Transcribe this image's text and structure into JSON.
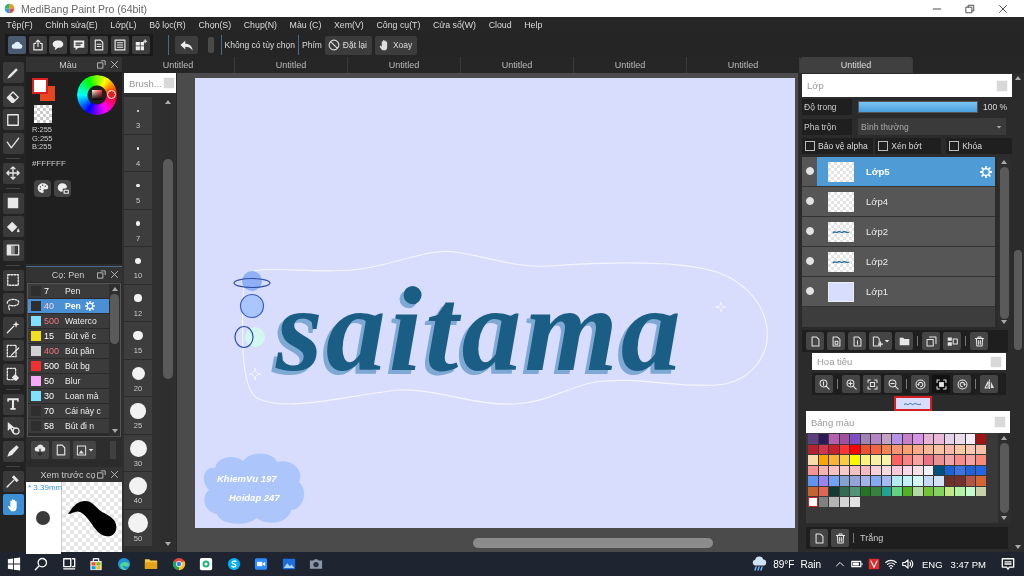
{
  "window": {
    "title": "MediBang Paint Pro (64bit)"
  },
  "menu": [
    "Tệp(F)",
    "Chỉnh sửa(E)",
    "Lớp(L)",
    "Bộ lọc(R)",
    "Chọn(S)",
    "Chụp(N)",
    "Màu (C)",
    "Xem(V)",
    "Công cụ(T)",
    "Cửa sổ(W)",
    "Cloud",
    "Help"
  ],
  "toolbar": {
    "options_text": "Không có tùy chọn",
    "key_label": "Phím",
    "buttons": [
      "Đặt lại",
      "Xoay"
    ]
  },
  "tools": [
    {
      "selected": false
    },
    {
      "selected": false
    },
    {
      "selected": false
    },
    {
      "selected": false
    },
    {
      "selected": false
    },
    {
      "selected": false
    },
    {
      "selected": false
    },
    {
      "selected": false
    },
    {
      "selected": false
    },
    {
      "selected": false
    },
    {
      "selected": false
    },
    {
      "selected": false
    },
    {
      "selected": false
    },
    {
      "selected": false
    },
    {
      "selected": false
    },
    {
      "selected": false
    },
    {
      "selected": false
    },
    {
      "selected": true
    }
  ],
  "color_panel": {
    "title": "Màu",
    "rgb": [
      "R:255",
      "G:255",
      "B:255"
    ],
    "hex": "#FFFFFF"
  },
  "brush_panel": {
    "title": "Cọ: Pen",
    "items": [
      {
        "color": "#2e2e2e",
        "size": "7",
        "size_highlighted": false,
        "name": "Pen",
        "selected": false
      },
      {
        "color": "#2e2e2e",
        "size": "40",
        "size_highlighted": true,
        "name": "Pen",
        "selected": true
      },
      {
        "color": "#7fe0ff",
        "size": "500",
        "size_highlighted": true,
        "name": "Waterco",
        "selected": false
      },
      {
        "color": "#f0e020",
        "size": "15",
        "size_highlighted": false,
        "name": "Bút vẽ c",
        "selected": false
      },
      {
        "color": "#d2d2d2",
        "size": "400",
        "size_highlighted": true,
        "name": "Bút pần",
        "selected": false
      },
      {
        "color": "#f03030",
        "size": "500",
        "size_highlighted": false,
        "name": "Bút bg",
        "selected": false
      },
      {
        "color": "#f8a8f8",
        "size": "50",
        "size_highlighted": false,
        "name": "Blur",
        "selected": false
      },
      {
        "color": "#7fe0ff",
        "size": "30",
        "size_highlighted": false,
        "name": "Loan mà",
        "selected": false
      },
      {
        "color": "#2e2e2e",
        "size": "70",
        "size_highlighted": false,
        "name": "Cái này c",
        "selected": false
      },
      {
        "color": "#2e2e2e",
        "size": "58",
        "size_highlighted": false,
        "name": "Bút đi n",
        "selected": false
      }
    ]
  },
  "brush_preview": {
    "title": "Xem trước cọ",
    "size": "* 3.39mm"
  },
  "brush_sizes": {
    "title": "Brush...",
    "items": [
      "3",
      "4",
      "5",
      "7",
      "10",
      "12",
      "15",
      "20",
      "25",
      "30",
      "40",
      "50"
    ]
  },
  "document_tabs": [
    {
      "label": "Untitled",
      "selected": false
    },
    {
      "label": "Untitled",
      "selected": false
    },
    {
      "label": "Untitled",
      "selected": false
    },
    {
      "label": "Untitled",
      "selected": false
    },
    {
      "label": "Untitled",
      "selected": false
    },
    {
      "label": "Untitled",
      "selected": false
    },
    {
      "label": "Untitled",
      "selected": true
    }
  ],
  "canvas": {
    "lettering": "saitama",
    "signature": [
      "KhiemVu 197",
      "Hoidap 247"
    ]
  },
  "layer_panel": {
    "title": "Lớp",
    "opacity_label": "Độ trong",
    "opacity": {
      "level": 1.0
    },
    "opacity_value": "100 %",
    "blend_label": "Pha trộn",
    "blend_mode": "Bình thường",
    "options": [
      {
        "label": "Bảo vệ alpha",
        "checked": false
      },
      {
        "label": "Xén bớt",
        "checked": false
      },
      {
        "label": "Khóa",
        "checked": false
      }
    ],
    "layers": [
      {
        "name": "Lớp5",
        "selected": true,
        "visible": true,
        "kind": "empty"
      },
      {
        "name": "Lớp4",
        "selected": false,
        "visible": true,
        "kind": "empty"
      },
      {
        "name": "Lớp2",
        "selected": false,
        "visible": true,
        "kind": "lettering"
      },
      {
        "name": "Lớp2",
        "selected": false,
        "visible": true,
        "kind": "lettering"
      },
      {
        "name": "Lớp1",
        "selected": false,
        "visible": true,
        "kind": "fill"
      }
    ]
  },
  "navigator": {
    "title": "Hoa tiêu"
  },
  "palette": {
    "title": "Bảng màu",
    "color_name": "Trắng",
    "swatches": [
      {
        "color": "#5c3f7e",
        "selected": false
      },
      {
        "color": "#2b1a55",
        "selected": false
      },
      {
        "color": "#b45fb0",
        "selected": false
      },
      {
        "color": "#a24f9f",
        "selected": false
      },
      {
        "color": "#7e4fc4",
        "selected": false
      },
      {
        "color": "#a182b4",
        "selected": false
      },
      {
        "color": "#b387c4",
        "selected": false
      },
      {
        "color": "#c4a2c4",
        "selected": false
      },
      {
        "color": "#b593e6",
        "selected": false
      },
      {
        "color": "#c682c6",
        "selected": false
      },
      {
        "color": "#d694e6",
        "selected": false
      },
      {
        "color": "#e6b3d6",
        "selected": false
      },
      {
        "color": "#ecb8da",
        "selected": false
      },
      {
        "color": "#e2d3ea",
        "selected": false
      },
      {
        "color": "#eadaea",
        "selected": false
      },
      {
        "color": "#f4ecfa",
        "selected": false
      },
      {
        "color": "#a01414",
        "selected": false
      },
      {
        "color": "#b42232",
        "selected": false
      },
      {
        "color": "#d2364a",
        "selected": false
      },
      {
        "color": "#c8202e",
        "selected": false
      },
      {
        "color": "#ff3434",
        "selected": false
      },
      {
        "color": "#ff0000",
        "selected": false
      },
      {
        "color": "#ea5232",
        "selected": false
      },
      {
        "color": "#f26444",
        "selected": false
      },
      {
        "color": "#f28452",
        "selected": false
      },
      {
        "color": "#f89474",
        "selected": false
      },
      {
        "color": "#f8a072",
        "selected": false
      },
      {
        "color": "#f8aa8a",
        "selected": false
      },
      {
        "color": "#f8b898",
        "selected": false
      },
      {
        "color": "#f8c2a2",
        "selected": false
      },
      {
        "color": "#f8b8aa",
        "selected": false
      },
      {
        "color": "#f8c8a2",
        "selected": false
      },
      {
        "color": "#f8c8b2",
        "selected": false
      },
      {
        "color": "#f8c0a8",
        "selected": false
      },
      {
        "color": "#f8dcaa",
        "selected": false
      },
      {
        "color": "#f8a800",
        "selected": false
      },
      {
        "color": "#f8b432",
        "selected": false
      },
      {
        "color": "#f8cc44",
        "selected": false
      },
      {
        "color": "#f8f800",
        "selected": false
      },
      {
        "color": "#f8f284",
        "selected": false
      },
      {
        "color": "#f8f0a2",
        "selected": false
      },
      {
        "color": "#f8f2aa",
        "selected": false
      },
      {
        "color": "#f86262",
        "selected": false
      },
      {
        "color": "#f88484",
        "selected": false
      },
      {
        "color": "#f8a2a2",
        "selected": false
      },
      {
        "color": "#ea7282",
        "selected": false
      },
      {
        "color": "#ea9292",
        "selected": false
      },
      {
        "color": "#f0a4a4",
        "selected": false
      },
      {
        "color": "#f88a8a",
        "selected": false
      },
      {
        "color": "#f8a2a0",
        "selected": false
      },
      {
        "color": "#f88a7a",
        "selected": false
      },
      {
        "color": "#f89494",
        "selected": false
      },
      {
        "color": "#f8b2b2",
        "selected": false
      },
      {
        "color": "#f8c2c2",
        "selected": false
      },
      {
        "color": "#f8caca",
        "selected": false
      },
      {
        "color": "#f2c2c2",
        "selected": false
      },
      {
        "color": "#f8bac2",
        "selected": false
      },
      {
        "color": "#f8d2da",
        "selected": false
      },
      {
        "color": "#f8dae2",
        "selected": false
      },
      {
        "color": "#f8cada",
        "selected": false
      },
      {
        "color": "#f8daea",
        "selected": false
      },
      {
        "color": "#f8e2ea",
        "selected": false
      },
      {
        "color": "#f4f2fa",
        "selected": false
      },
      {
        "color": "#00527e",
        "selected": false
      },
      {
        "color": "#1c62d2",
        "selected": false
      },
      {
        "color": "#3a74e2",
        "selected": false
      },
      {
        "color": "#2262d8",
        "selected": false
      },
      {
        "color": "#2466e0",
        "selected": false
      },
      {
        "color": "#6294f2",
        "selected": false
      },
      {
        "color": "#9a84f2",
        "selected": false
      },
      {
        "color": "#72a2f2",
        "selected": false
      },
      {
        "color": "#84a2d2",
        "selected": false
      },
      {
        "color": "#94a4da",
        "selected": false
      },
      {
        "color": "#a4b4ea",
        "selected": false
      },
      {
        "color": "#84aaf2",
        "selected": false
      },
      {
        "color": "#a4baf2",
        "selected": false
      },
      {
        "color": "#b4eaf2",
        "selected": false
      },
      {
        "color": "#c4f2fa",
        "selected": false
      },
      {
        "color": "#d4fafa",
        "selected": false
      },
      {
        "color": "#c4daf8",
        "selected": false
      },
      {
        "color": "#d4e2f8",
        "selected": false
      },
      {
        "color": "#6c3028",
        "selected": false
      },
      {
        "color": "#74302a",
        "selected": false
      },
      {
        "color": "#b45444",
        "selected": false
      },
      {
        "color": "#d46432",
        "selected": false
      },
      {
        "color": "#c46432",
        "selected": false
      },
      {
        "color": "#e26454",
        "selected": false
      },
      {
        "color": "#123a32",
        "selected": false
      },
      {
        "color": "#326a52",
        "selected": false
      },
      {
        "color": "#52947a",
        "selected": false
      },
      {
        "color": "#247424",
        "selected": false
      },
      {
        "color": "#34843e",
        "selected": false
      },
      {
        "color": "#22a294",
        "selected": false
      },
      {
        "color": "#62d282",
        "selected": false
      },
      {
        "color": "#52b224",
        "selected": false
      },
      {
        "color": "#b2daa2",
        "selected": false
      },
      {
        "color": "#72c232",
        "selected": false
      },
      {
        "color": "#84d262",
        "selected": false
      },
      {
        "color": "#c2ea84",
        "selected": false
      },
      {
        "color": "#b2f2a2",
        "selected": false
      },
      {
        "color": "#c4facc",
        "selected": false
      },
      {
        "color": "#c8d2aa",
        "selected": false
      },
      {
        "color": "#ffffff",
        "selected": true
      },
      {
        "color": "#808080",
        "selected": false
      },
      {
        "color": "#b4b4b4",
        "selected": false
      },
      {
        "color": "#d4d4d4",
        "selected": false
      },
      {
        "color": "#e2e2e2",
        "selected": false
      }
    ]
  },
  "taskbar": {
    "temperature": "89°F",
    "weather": "Rain",
    "language": "ENG",
    "time": "3:47 PM"
  }
}
